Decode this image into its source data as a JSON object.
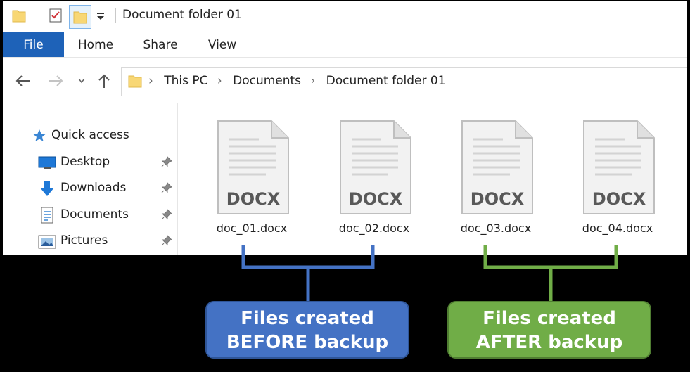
{
  "window": {
    "title": "Document folder 01"
  },
  "ribbon": {
    "tabs": [
      "File",
      "Home",
      "Share",
      "View"
    ]
  },
  "address": {
    "crumbs": [
      "This PC",
      "Documents",
      "Document folder 01"
    ]
  },
  "navpane": {
    "quick_access": "Quick access",
    "items": [
      "Desktop",
      "Downloads",
      "Documents",
      "Pictures"
    ]
  },
  "files": [
    {
      "name": "doc_01.docx",
      "badge": "DOCX"
    },
    {
      "name": "doc_02.docx",
      "badge": "DOCX"
    },
    {
      "name": "doc_03.docx",
      "badge": "DOCX"
    },
    {
      "name": "doc_04.docx",
      "badge": "DOCX"
    }
  ],
  "callouts": {
    "before": {
      "line1": "Files created",
      "line2": "BEFORE backup",
      "color": "#4472c4"
    },
    "after": {
      "line1": "Files created",
      "line2": "AFTER backup",
      "color": "#70ad47"
    }
  },
  "colors": {
    "file_tab": "#1e62b8",
    "folder": "#f8d775"
  }
}
